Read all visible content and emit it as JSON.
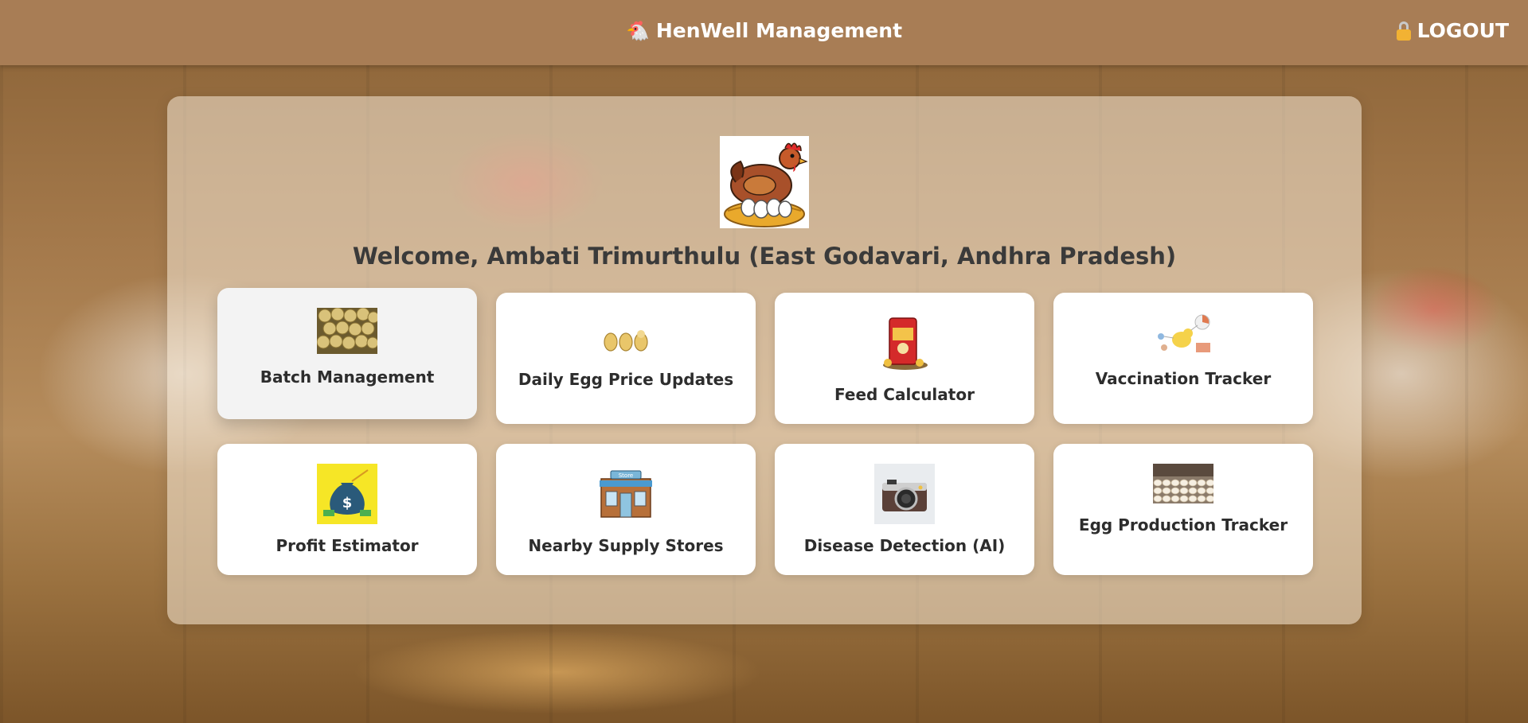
{
  "header": {
    "brand_icon": "chicken-icon",
    "brand_title": "HenWell Management",
    "logout_icon": "lock-icon",
    "logout_label": "LOGOUT"
  },
  "welcome": {
    "text": "Welcome, Ambati Trimurthulu (East Godavari, Andhra Pradesh)",
    "logo": "hen-on-nest-logo"
  },
  "tiles": [
    {
      "label": "Batch Management",
      "icon": "chicks-photo-icon",
      "state": "hover"
    },
    {
      "label": "Daily Egg Price Updates",
      "icon": "eggs-icon"
    },
    {
      "label": "Feed Calculator",
      "icon": "feed-bag-icon"
    },
    {
      "label": "Vaccination Tracker",
      "icon": "vaccination-chart-icon"
    },
    {
      "label": "Profit Estimator",
      "icon": "money-bag-icon"
    },
    {
      "label": "Nearby Supply Stores",
      "icon": "store-icon"
    },
    {
      "label": "Disease Detection (AI)",
      "icon": "camera-icon"
    },
    {
      "label": "Egg Production Tracker",
      "icon": "egg-trays-photo-icon"
    }
  ],
  "colors": {
    "header_bg": "#a87d55",
    "panel_bg": "#f4e8d6",
    "card_bg": "#ffffff",
    "text_dark": "#3a3a3a"
  }
}
